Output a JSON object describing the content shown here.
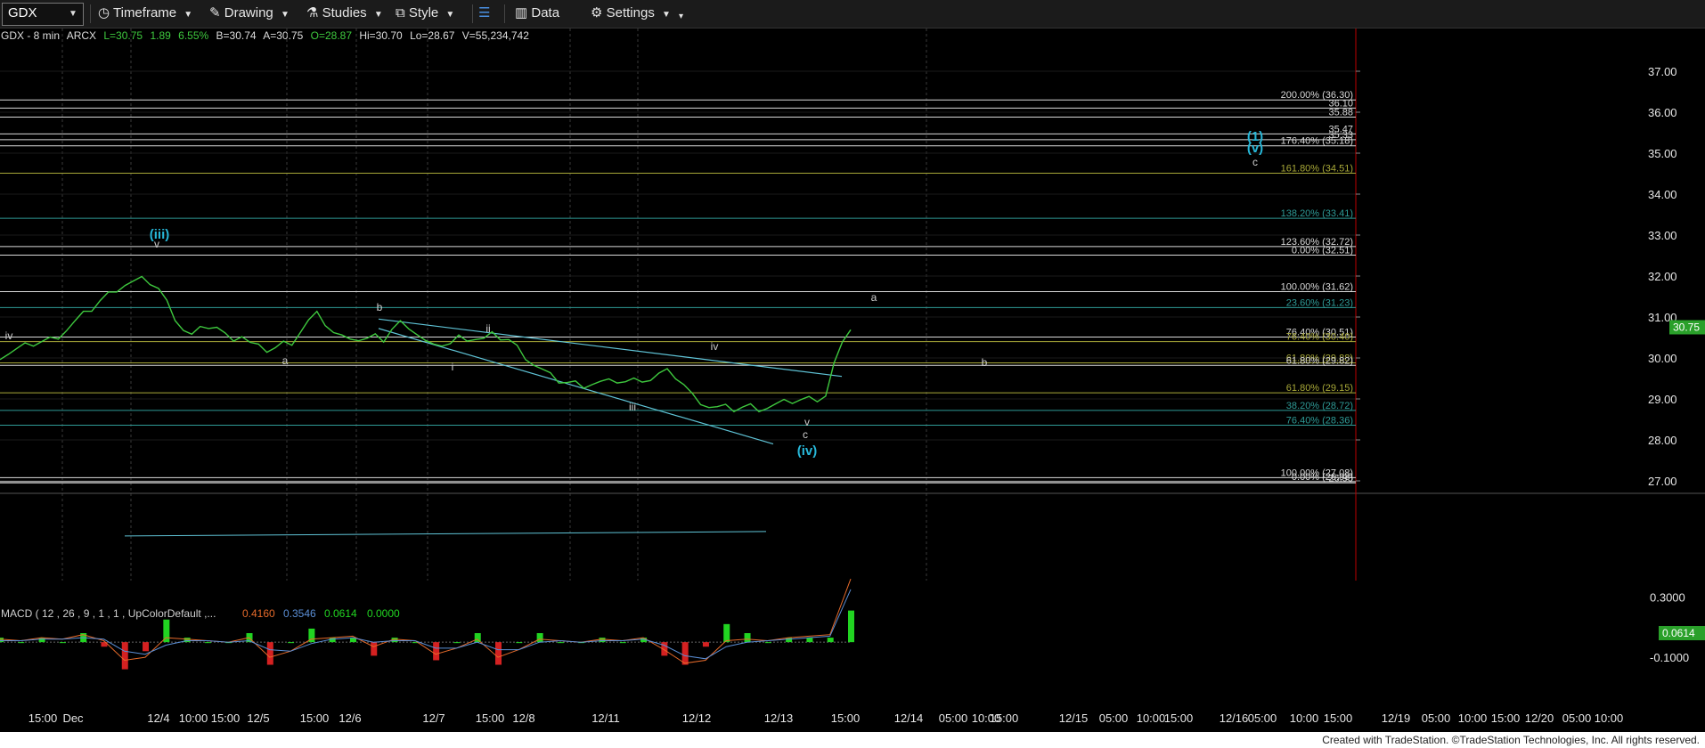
{
  "toolbar": {
    "symbol": "GDX",
    "timeframe_label": "Timeframe",
    "drawing_label": "Drawing",
    "studies_label": "Studies",
    "style_label": "Style",
    "data_label": "Data",
    "settings_label": "Settings"
  },
  "header": {
    "name": "GDX - 8 min",
    "exchange": "ARCX",
    "last": "L=30.75",
    "change": "1.89",
    "pct": "6.55%",
    "bid": "B=30.74",
    "ask": "A=30.75",
    "open": "O=28.87",
    "high": "Hi=30.70",
    "low": "Lo=28.67",
    "volume": "V=55,234,742"
  },
  "colors": {
    "background": "#000000",
    "price_line": "#3ec83e",
    "wave_label_major": "#27b7d8",
    "trendline": "#5fc3d6",
    "macd_line": "#e56a2a",
    "signal_line": "#5b8fd6",
    "hist_up": "#21d421",
    "hist_down": "#d42121",
    "last_price_box": "#2aa02a"
  },
  "chart_data": [
    {
      "type": "line",
      "title": "GDX - 8 min",
      "ylim": [
        26.8,
        38.2
      ],
      "y_ticks": [
        "37.00",
        "36.00",
        "35.00",
        "34.00",
        "33.00",
        "32.00",
        "31.00",
        "30.00",
        "29.00",
        "28.00",
        "27.00"
      ],
      "x_tick_labels": [
        "15:00",
        "Dec",
        "12/4",
        "10:00",
        "15:00",
        "12/5",
        "15:00",
        "12/6",
        "12/7",
        "15:00",
        "12/8",
        "12/11",
        "12/12",
        "12/13",
        "15:00",
        "12/14",
        "05:00",
        "10:00",
        "15:00",
        "12/15",
        "05:00",
        "10:00",
        "15:00",
        "12/16",
        "05:00",
        "10:00",
        "15:00",
        "12/19",
        "05:00",
        "10:00",
        "15:00",
        "12/20",
        "05:00",
        "10:00"
      ],
      "series": [
        {
          "values": [
            30.05,
            30.12,
            30.2,
            30.28,
            30.35,
            30.4,
            30.45,
            30.55,
            30.7,
            30.88,
            31.05,
            31.2,
            31.4,
            31.55,
            31.7,
            31.8,
            31.85,
            31.9,
            31.85,
            31.7,
            31.35,
            31.0,
            30.7,
            30.55,
            30.68,
            30.78,
            30.75,
            30.55,
            30.5,
            30.55,
            30.35,
            30.25,
            30.2,
            30.25,
            30.35,
            30.4,
            30.65,
            30.9,
            31.05,
            30.85,
            30.62,
            30.5,
            30.55,
            30.45,
            30.45,
            30.5,
            30.45,
            30.7,
            30.85,
            30.8,
            30.6,
            30.4,
            30.25,
            30.35,
            30.35,
            30.5,
            30.5,
            30.48,
            30.45,
            30.55,
            30.5,
            30.45,
            30.25,
            30.05,
            29.85,
            29.7,
            29.55,
            29.45,
            29.4,
            29.38,
            29.35,
            29.38,
            29.4,
            29.4,
            29.45,
            29.42,
            29.45,
            29.5,
            29.48,
            29.6,
            29.65,
            29.55,
            29.35,
            29.08,
            28.95,
            28.82,
            28.78,
            28.78,
            28.75,
            28.8,
            28.82,
            28.78,
            28.8,
            28.85,
            28.9,
            28.95,
            28.98,
            29.0,
            29.02,
            29.1,
            29.85,
            30.3,
            30.75
          ]
        }
      ],
      "horizontal_levels": [
        {
          "price": 36.3,
          "label": "200.00% (36.30)",
          "color": "#d9d9d9"
        },
        {
          "price": 36.1,
          "label": "36.10",
          "color": "#d9d9d9"
        },
        {
          "price": 35.88,
          "label": "35.88",
          "color": "#d9d9d9"
        },
        {
          "price": 35.47,
          "label": "35.47",
          "color": "#d9d9d9"
        },
        {
          "price": 35.33,
          "label": "35.33",
          "color": "#d9d9d9"
        },
        {
          "price": 35.18,
          "label": "176.40% (35.18)",
          "color": "#d9d9d9"
        },
        {
          "price": 34.51,
          "label": "161.80% (34.51)",
          "color": "#a8a838"
        },
        {
          "price": 33.41,
          "label": "138.20% (33.41)",
          "color": "#2e9a96"
        },
        {
          "price": 32.72,
          "label": "123.60% (32.72)",
          "color": "#d9d9d9"
        },
        {
          "price": 32.51,
          "label": "0.00% (32.51)",
          "color": "#d9d9d9"
        },
        {
          "price": 31.62,
          "label": "100.00% (31.62)",
          "color": "#d9d9d9"
        },
        {
          "price": 31.23,
          "label": "23.60% (31.23)",
          "color": "#2e9a96"
        },
        {
          "price": 30.51,
          "label": "76.40% (30.51)",
          "color": "#d9d9d9"
        },
        {
          "price": 30.4,
          "label": "76.40% (30.40)",
          "color": "#a8a838"
        },
        {
          "price": 29.88,
          "label": "61.80% (29.88)",
          "color": "#a8a838"
        },
        {
          "price": 29.82,
          "label": "61.80% (29.82)",
          "color": "#d9d9d9"
        },
        {
          "price": 29.15,
          "label": "61.80% (29.15)",
          "color": "#a8a838"
        },
        {
          "price": 28.72,
          "label": "38.20% (28.72)",
          "color": "#2e9a96"
        },
        {
          "price": 28.36,
          "label": "76.40% (28.36)",
          "color": "#2e9a96"
        },
        {
          "price": 27.08,
          "label": "100.00% (27.08)",
          "color": "#d9d9d9"
        },
        {
          "price": 26.98,
          "label": "0.00% (26.98)",
          "color": "#d9d9d9"
        },
        {
          "price": 26.95,
          "label": "26.95",
          "color": "#d9d9d9"
        }
      ],
      "wave_labels": [
        {
          "text": "(iii)",
          "major": true
        },
        {
          "text": "v",
          "major": false
        },
        {
          "text": "iv",
          "major": false
        },
        {
          "text": "a",
          "major": false
        },
        {
          "text": "b",
          "major": false
        },
        {
          "text": "i",
          "major": false
        },
        {
          "text": "ii",
          "major": false
        },
        {
          "text": "iii",
          "major": false
        },
        {
          "text": "iv",
          "major": false
        },
        {
          "text": "v",
          "major": false
        },
        {
          "text": "c",
          "major": false
        },
        {
          "text": "(iv)",
          "major": true
        },
        {
          "text": "a",
          "major": false
        },
        {
          "text": "b",
          "major": false
        },
        {
          "text": "(1)",
          "major": true
        },
        {
          "text": "(v)",
          "major": true
        },
        {
          "text": "c",
          "major": false
        }
      ],
      "last_price": "30.75"
    },
    {
      "type": "line",
      "title": "MACD ( 12 , 26 , 9 , 1 , 1 , UpColorDefault ,...",
      "legend_values": [
        "0.4160",
        "0.3546",
        "0.0614",
        "0.0000"
      ],
      "ylim": [
        -0.2,
        0.45
      ],
      "y_ticks": [
        "0.3000",
        "-0.1000"
      ],
      "series": [
        {
          "values": [
            0.02,
            0.01,
            0.03,
            0.02,
            0.05,
            0.01,
            -0.12,
            -0.1,
            0.03,
            0.02,
            0.01,
            0.0,
            0.03,
            -0.1,
            -0.06,
            0.02,
            0.03,
            0.04,
            -0.03,
            0.02,
            0.01,
            -0.08,
            -0.04,
            0.02,
            -0.1,
            -0.05,
            0.02,
            0.01,
            0.0,
            0.02,
            0.01,
            0.03,
            -0.05,
            -0.14,
            -0.12,
            0.01,
            0.02,
            0.01,
            0.03,
            0.04,
            0.05,
            0.42
          ]
        },
        {
          "values": [
            0.01,
            0.01,
            0.02,
            0.02,
            0.03,
            0.02,
            -0.06,
            -0.08,
            -0.02,
            0.01,
            0.01,
            0.0,
            0.01,
            -0.05,
            -0.06,
            -0.01,
            0.02,
            0.03,
            0.0,
            0.01,
            0.01,
            -0.04,
            -0.04,
            0.0,
            -0.05,
            -0.05,
            0.0,
            0.01,
            0.0,
            0.01,
            0.01,
            0.02,
            -0.02,
            -0.09,
            -0.11,
            -0.03,
            0.0,
            0.01,
            0.02,
            0.03,
            0.04,
            0.35
          ]
        }
      ],
      "histogram_last": "0.0614"
    }
  ],
  "footer": {
    "credit": "Created with TradeStation. ©TradeStation Technologies, Inc. All rights reserved."
  }
}
